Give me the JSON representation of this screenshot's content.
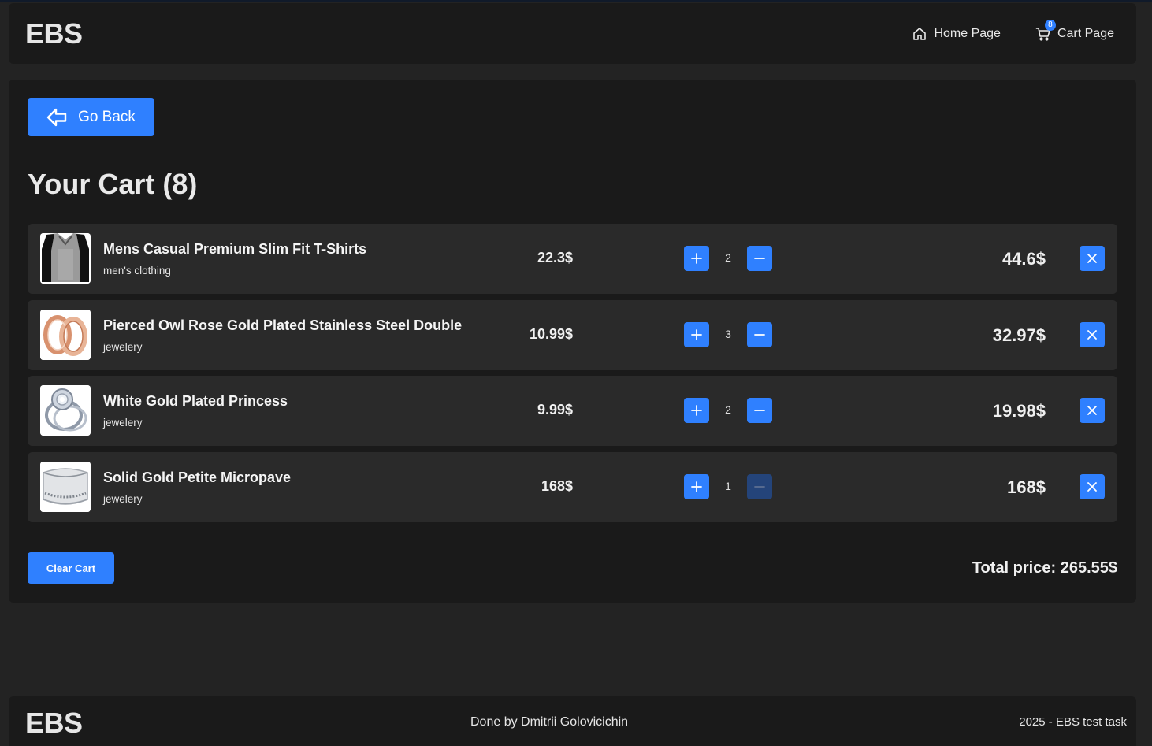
{
  "header": {
    "logo": "EBS",
    "nav": {
      "home_label": "Home Page",
      "cart_label": "Cart Page",
      "cart_count": "8"
    }
  },
  "main": {
    "go_back_label": "Go Back",
    "title": "Your Cart (8)",
    "items": [
      {
        "title": "Mens Casual Premium Slim Fit T-Shirts",
        "category": "men's clothing",
        "unit_price": "22.3$",
        "quantity": "2",
        "line_total": "44.6$",
        "thumbnail": "tshirt-image"
      },
      {
        "title": "Pierced Owl Rose Gold Plated Stainless Steel Double",
        "category": "jewelery",
        "unit_price": "10.99$",
        "quantity": "3",
        "line_total": "32.97$",
        "thumbnail": "rose-gold-rings-image"
      },
      {
        "title": "White Gold Plated Princess",
        "category": "jewelery",
        "unit_price": "9.99$",
        "quantity": "2",
        "line_total": "19.98$",
        "thumbnail": "diamond-ring-image"
      },
      {
        "title": "Solid Gold Petite Micropave",
        "category": "jewelery",
        "unit_price": "168$",
        "quantity": "1",
        "line_total": "168$",
        "thumbnail": "band-ring-image"
      }
    ],
    "clear_label": "Clear Cart",
    "total_label": "Total price: 265.55$"
  },
  "footer": {
    "logo": "EBS",
    "credit": "Done by Dmitrii Golovicichin",
    "copyright": "2025 - EBS test task"
  },
  "colors": {
    "accent": "#2f80ff",
    "background": "#232323",
    "panel": "#1a1a1a",
    "row": "#2a2a2a"
  }
}
